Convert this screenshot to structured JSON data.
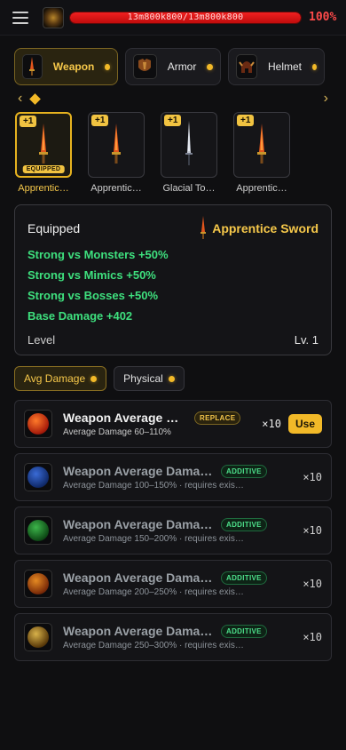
{
  "header": {
    "hp_text": "13m800k800/13m800k800",
    "hp_fraction": 1.0,
    "hp_percent": "100%"
  },
  "tabs": [
    {
      "label": "Weapon",
      "active": true,
      "icon": "sword-icon"
    },
    {
      "label": "Armor",
      "active": false,
      "icon": "armor-icon"
    },
    {
      "label": "Helmet",
      "active": false,
      "icon": "helmet-icon"
    }
  ],
  "items": [
    {
      "name": "Apprentic…",
      "badge": "+1",
      "equipped_label": "EQUIPPED",
      "equipped": true,
      "icon": "fire-sword-icon"
    },
    {
      "name": "Apprentic…",
      "badge": "+1",
      "equipped": false,
      "icon": "fire-sword-icon"
    },
    {
      "name": "Glacial To…",
      "badge": "+1",
      "equipped": false,
      "icon": "ice-sword-icon"
    },
    {
      "name": "Apprentic…",
      "badge": "+1",
      "equipped": false,
      "icon": "fire-sword-icon"
    }
  ],
  "equipped": {
    "title": "Equipped",
    "name": "Apprentice Sword",
    "stats": [
      "Strong vs Monsters +50%",
      "Strong vs Mimics +50%",
      "Strong vs Bosses +50%",
      "Base Damage +402"
    ],
    "level_label": "Level",
    "level_value": "Lv. 1"
  },
  "filters": [
    {
      "label": "Avg Damage",
      "active": true
    },
    {
      "label": "Physical",
      "active": false
    }
  ],
  "list": [
    {
      "title": "Weapon Average Da…",
      "tag": "REPLACE",
      "sub": "Average Damage 60–110%",
      "count": "×10",
      "button": "Use",
      "icon": "red-orb-icon",
      "colors": [
        "#ff7a2a",
        "#a51a0a"
      ]
    },
    {
      "title": "Weapon Average Damage…",
      "tag": "ADDITIVE",
      "sub": "Average Damage 100–150% · requires exis…",
      "count": "×10",
      "icon": "blue-orb-icon",
      "colors": [
        "#3a6bd6",
        "#102a6a"
      ]
    },
    {
      "title": "Weapon Average Damage…",
      "tag": "ADDITIVE",
      "sub": "Average Damage 150–200% · requires exis…",
      "count": "×10",
      "icon": "green-orb-icon",
      "colors": [
        "#3cb54a",
        "#0e4a16"
      ]
    },
    {
      "title": "Weapon Average Damage…",
      "tag": "ADDITIVE",
      "sub": "Average Damage 200–250% · requires exis…",
      "count": "×10",
      "icon": "orange-orb-icon",
      "colors": [
        "#e58a22",
        "#7a2a08"
      ]
    },
    {
      "title": "Weapon Average Damage…",
      "tag": "ADDITIVE",
      "sub": "Average Damage 250–300% · requires exis…",
      "count": "×10",
      "icon": "gold-orb-icon",
      "colors": [
        "#d8b24a",
        "#5a3a0a"
      ]
    }
  ]
}
